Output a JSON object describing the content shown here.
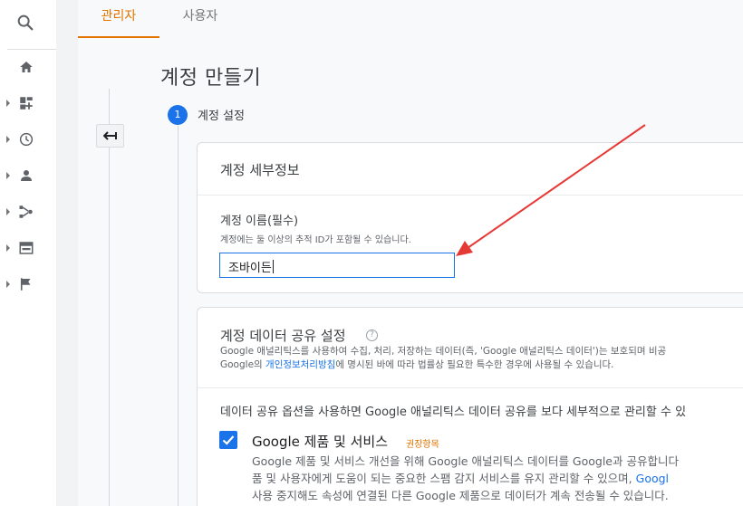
{
  "tabs": {
    "admin": "관리자",
    "user": "사용자"
  },
  "page": {
    "title": "계정 만들기"
  },
  "step": {
    "number": "1",
    "label": "계정 설정"
  },
  "account_details": {
    "header": "계정 세부정보",
    "name_label": "계정 이름(필수)",
    "name_help": "계정에는 둘 이상의 추적 ID가 포함될 수 있습니다.",
    "name_value": "조바이든"
  },
  "data_sharing": {
    "title": "계정 데이터 공유 설정",
    "help": "?",
    "desc_line1": "Google 애널리틱스를 사용하여 수집, 처리, 저장하는 데이터(즉, 'Google 애널리틱스 데이터')는 보호되며 비공",
    "desc_line2_pre": "Google의 ",
    "desc_line2_link": "개인정보처리방침",
    "desc_line2_post": "에 명시된 바에 따라 법률상 필요한 특수한 경우에 사용될 수 있습니다.",
    "options_intro": "데이터 공유 옵션을 사용하면 Google 애널리틱스 데이터 공유를 보다 세부적으로 관리할 수 있",
    "option": {
      "title": "Google 제품 및 서비스",
      "badge": "권장항목",
      "checked": true,
      "line1": "Google 제품 및 서비스 개선을 위해 Google 애널리틱스 데이터를 Google과 공유합니다",
      "line2_pre": "품 및 사용자에게 도움이 되는 중요한 스팸 감지 서비스를 유지 관리할 수 있으며, ",
      "line2_link": "Googl",
      "line3": "사용 중지해도 속성에 연결된 다른 Google 제품으로 데이터가 계속 전송될 수 있습니다."
    }
  },
  "icons": {
    "search": "search-icon",
    "home": "home-icon",
    "dashboard": "customization-icon",
    "clock": "realtime-icon",
    "person": "audience-icon",
    "share": "acquisition-icon",
    "card": "behavior-icon",
    "flag": "conversions-icon",
    "back": "back-arrow-icon"
  },
  "colors": {
    "accent": "#e37400",
    "primary": "#1a73e8",
    "arrow": "#e53935"
  }
}
